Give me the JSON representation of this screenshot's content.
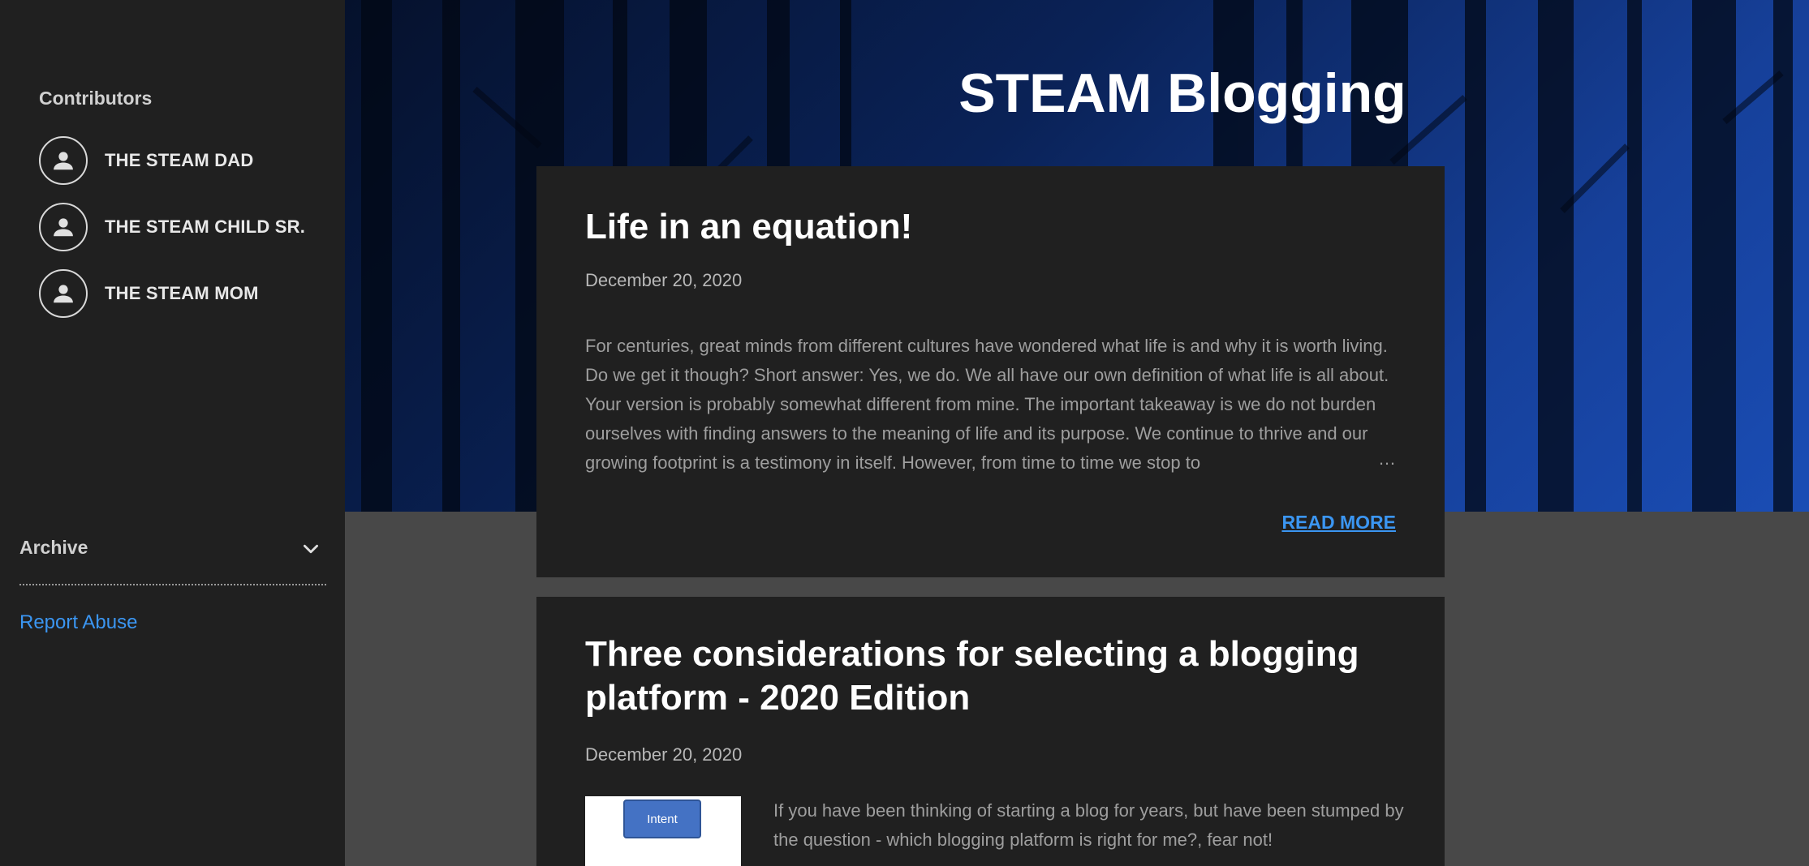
{
  "sidebar": {
    "contributors_title": "Contributors",
    "contributors": [
      {
        "name": "THE STEAM DAD"
      },
      {
        "name": "THE STEAM CHILD SR."
      },
      {
        "name": "THE STEAM MOM"
      }
    ],
    "archive_label": "Archive",
    "report_abuse": "Report Abuse"
  },
  "header": {
    "blog_title": "STEAM Blogging"
  },
  "posts": [
    {
      "title": "Life in an equation!",
      "date": "December 20, 2020",
      "snippet": "For centuries, great minds from different cultures have wondered what life is and why it is worth living. Do we get it though? Short answer: Yes, we do. We all have our own definition of what life is all about. Your version is probably somewhat different from mine. The important takeaway is we do not burden ourselves with finding answers to the meaning of life and its purpose. We continue to thrive and our growing footprint is a testimony in itself. However, from time to time we stop to",
      "ellipsis": "…",
      "read_more": "READ MORE"
    },
    {
      "title_line1": "Three considerations for selecting a blogging",
      "title_line2": "platform - 2020 Edition",
      "date": "December 20, 2020",
      "thumb_label": "Intent",
      "snippet": "  If you have been thinking of starting a blog for years, but have been stumped by the question - which blogging platform is right for me?, fear not!"
    }
  ],
  "colors": {
    "accent": "#3b96f2",
    "sidebar_bg": "#202020",
    "card_bg": "#202020",
    "page_bg": "#484848"
  }
}
